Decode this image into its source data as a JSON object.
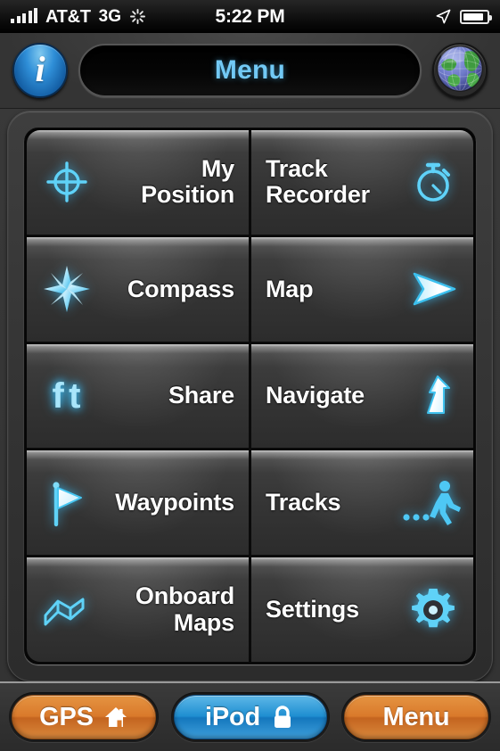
{
  "status_bar": {
    "carrier": "AT&T",
    "network": "3G",
    "time": "5:22 PM",
    "signal_bars": 5,
    "activity_indicator": "spinner-icon",
    "location_icon": "location-arrow-icon",
    "battery_icon": "battery-icon",
    "battery_level": 88
  },
  "nav_bar": {
    "info_button": {
      "icon": "info-icon",
      "glyph": "i"
    },
    "title": "Menu",
    "globe_button": {
      "icon": "globe-icon"
    }
  },
  "menu_grid": {
    "tiles": [
      {
        "label": "My\nPosition",
        "icon": "crosshair-target-icon",
        "align": "left"
      },
      {
        "label": "Track\nRecorder",
        "icon": "stopwatch-icon",
        "align": "right"
      },
      {
        "label": "Compass",
        "icon": "compass-rose-icon",
        "align": "left"
      },
      {
        "label": "Map",
        "icon": "arrow-cursor-icon",
        "align": "right"
      },
      {
        "label": "Share",
        "icon": "facebook-twitter-icon",
        "align": "left"
      },
      {
        "label": "Navigate",
        "icon": "navigation-arrow-icon",
        "align": "right"
      },
      {
        "label": "Waypoints",
        "icon": "flag-icon",
        "align": "left"
      },
      {
        "label": "Tracks",
        "icon": "walking-person-icon",
        "align": "right"
      },
      {
        "label": "Onboard\nMaps",
        "icon": "folded-map-icon",
        "align": "left"
      },
      {
        "label": "Settings",
        "icon": "gear-icon",
        "align": "right"
      }
    ]
  },
  "toolbar": {
    "gps_label": "GPS",
    "gps_icon": "home-icon",
    "ipod_label": "iPod",
    "ipod_icon": "lock-icon",
    "menu_label": "Menu"
  },
  "colors": {
    "accent_cyan": "#4ec8f5",
    "title_blue": "#72c9f5",
    "orange": "#d9792b",
    "blue": "#1e8ed1",
    "tile_bg": "#343434",
    "panel_bg": "#343434"
  }
}
